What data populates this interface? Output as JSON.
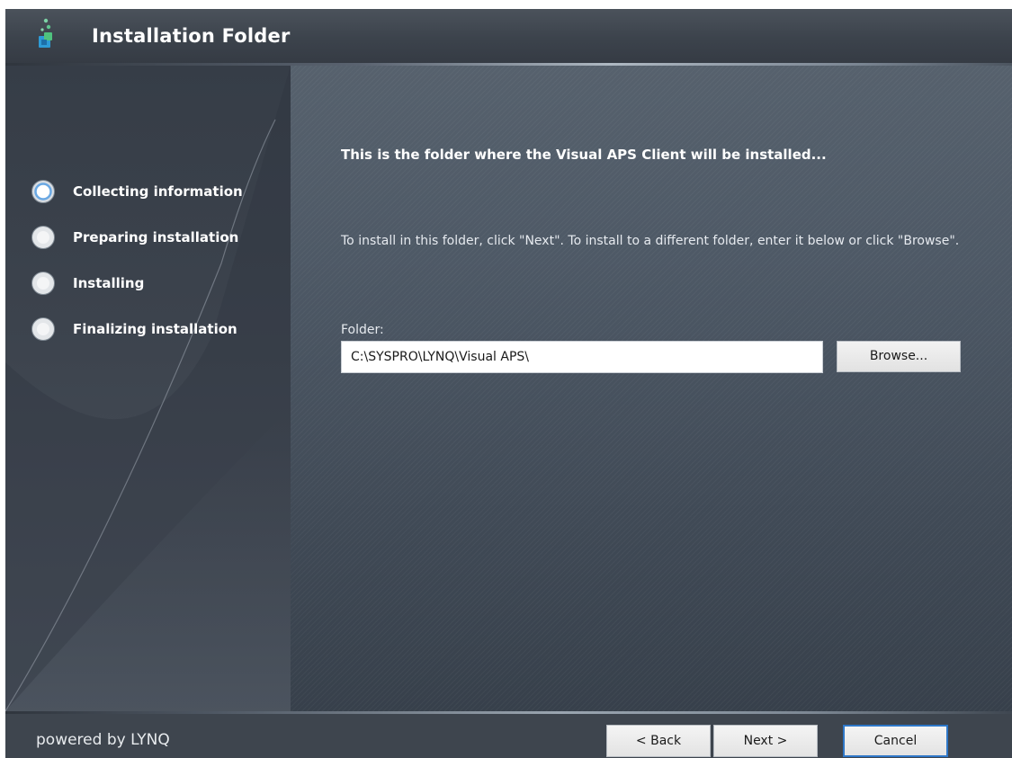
{
  "window": {
    "title": "Installation Folder"
  },
  "sidebar": {
    "steps": [
      {
        "label": "Collecting information",
        "state": "current"
      },
      {
        "label": "Preparing installation",
        "state": "pending"
      },
      {
        "label": "Installing",
        "state": "pending"
      },
      {
        "label": "Finalizing installation",
        "state": "pending"
      }
    ]
  },
  "main": {
    "heading": "This is the folder where the Visual APS Client will be installed...",
    "instruction": "To install in this folder, click \"Next\". To install to a different folder, enter it below or click \"Browse\".",
    "folder_label": "Folder:",
    "folder_value": "C:\\SYSPRO\\LYNQ\\Visual APS\\",
    "browse_label": "Browse..."
  },
  "footer": {
    "powered_by": "powered by LYNQ",
    "back_label": "< Back",
    "next_label": "Next >",
    "cancel_label": "Cancel"
  },
  "colors": {
    "title_text": "#ffffff",
    "focus_border": "#2e77c8",
    "panel": "#4b5663",
    "sidebar": "#3c434d"
  },
  "icons": {
    "app": "installer-app-icon",
    "step_current": "radio-selected-icon",
    "step_pending": "radio-unselected-icon"
  }
}
